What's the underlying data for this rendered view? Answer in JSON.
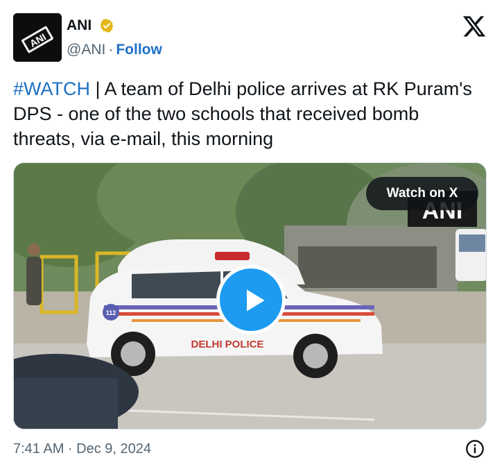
{
  "author": {
    "name": "ANI",
    "handle": "@ANI",
    "separator": "·",
    "follow_label": "Follow",
    "avatar_text": "ANI",
    "verified": "gold-verified-badge"
  },
  "platform_icon": "x-logo",
  "tweet": {
    "hashtag": "#WATCH",
    "body": " | A team of Delhi police arrives at RK Puram's DPS - one of the two schools that received bomb threats, via e-mail, this morning"
  },
  "media": {
    "type": "video",
    "watch_label": "Watch on X",
    "watermark": "ANI",
    "car_label": "DELHI POLICE",
    "car_number": "112",
    "play_icon": "play-icon"
  },
  "footer": {
    "timestamp": "7:41 AM · Dec 9, 2024",
    "info_icon": "info-icon"
  },
  "colors": {
    "link_blue": "#1d6fc4",
    "play_blue": "#1d9bf0",
    "text_primary": "#0f1419",
    "text_secondary": "#536471",
    "verified_gold": "#e2b719"
  }
}
